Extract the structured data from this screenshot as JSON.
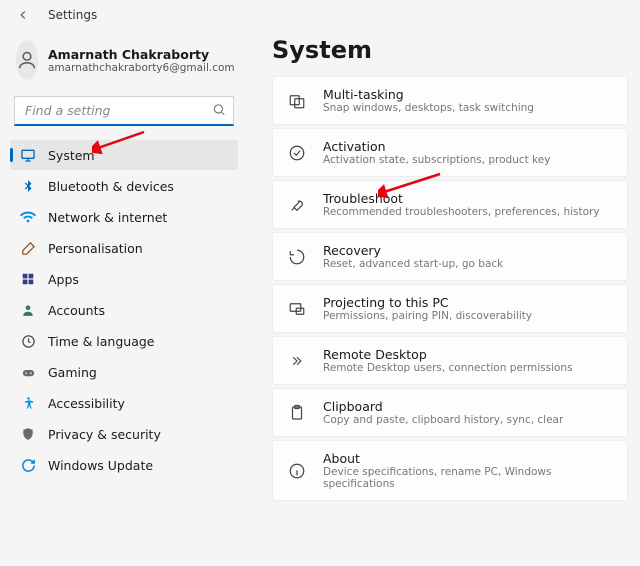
{
  "window": {
    "title": "Settings"
  },
  "profile": {
    "name": "Amarnath Chakraborty",
    "email": "amarnathchakraborty6@gmail.com"
  },
  "search": {
    "placeholder": "Find a setting"
  },
  "sidebar": {
    "items": [
      {
        "label": "System",
        "icon": "system"
      },
      {
        "label": "Bluetooth & devices",
        "icon": "bluetooth"
      },
      {
        "label": "Network & internet",
        "icon": "wifi"
      },
      {
        "label": "Personalisation",
        "icon": "brush"
      },
      {
        "label": "Apps",
        "icon": "apps"
      },
      {
        "label": "Accounts",
        "icon": "person"
      },
      {
        "label": "Time & language",
        "icon": "clock"
      },
      {
        "label": "Gaming",
        "icon": "gaming"
      },
      {
        "label": "Accessibility",
        "icon": "accessibility"
      },
      {
        "label": "Privacy & security",
        "icon": "shield"
      },
      {
        "label": "Windows Update",
        "icon": "update"
      }
    ]
  },
  "page": {
    "title": "System"
  },
  "cards": [
    {
      "title": "Multi-tasking",
      "sub": "Snap windows, desktops, task switching",
      "icon": "multitask"
    },
    {
      "title": "Activation",
      "sub": "Activation state, subscriptions, product key",
      "icon": "activation"
    },
    {
      "title": "Troubleshoot",
      "sub": "Recommended troubleshooters, preferences, history",
      "icon": "troubleshoot"
    },
    {
      "title": "Recovery",
      "sub": "Reset, advanced start-up, go back",
      "icon": "recovery"
    },
    {
      "title": "Projecting to this PC",
      "sub": "Permissions, pairing PIN, discoverability",
      "icon": "project"
    },
    {
      "title": "Remote Desktop",
      "sub": "Remote Desktop users, connection permissions",
      "icon": "remote"
    },
    {
      "title": "Clipboard",
      "sub": "Copy and paste, clipboard history, sync, clear",
      "icon": "clipboard"
    },
    {
      "title": "About",
      "sub": "Device specifications, rename PC, Windows specifications",
      "icon": "about"
    }
  ]
}
